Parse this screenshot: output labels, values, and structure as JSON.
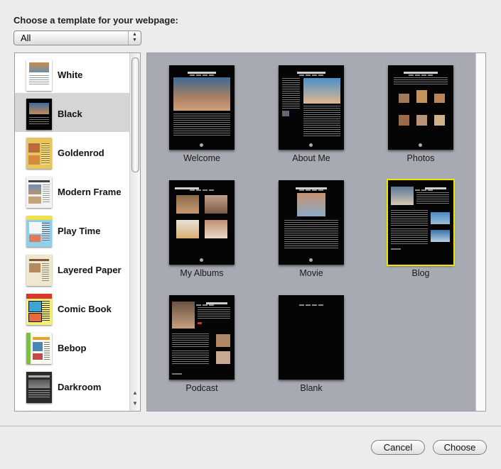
{
  "dialog": {
    "title": "Choose a template for your webpage:",
    "filter": {
      "selected": "All"
    }
  },
  "themes": [
    {
      "label": "White"
    },
    {
      "label": "Black"
    },
    {
      "label": "Goldenrod"
    },
    {
      "label": "Modern Frame"
    },
    {
      "label": "Play Time"
    },
    {
      "label": "Layered Paper"
    },
    {
      "label": "Comic Book"
    },
    {
      "label": "Bebop"
    },
    {
      "label": "Darkroom"
    }
  ],
  "selected_theme": "Black",
  "templates": [
    {
      "label": "Welcome"
    },
    {
      "label": "About Me"
    },
    {
      "label": "Photos"
    },
    {
      "label": "My Albums"
    },
    {
      "label": "Movie"
    },
    {
      "label": "Blog"
    },
    {
      "label": "Podcast"
    },
    {
      "label": "Blank"
    }
  ],
  "selected_template": "Blog",
  "buttons": {
    "cancel": "Cancel",
    "choose": "Choose"
  },
  "colors": {
    "selection_outline": "#f2e400",
    "grid_background": "#a7aab2"
  }
}
